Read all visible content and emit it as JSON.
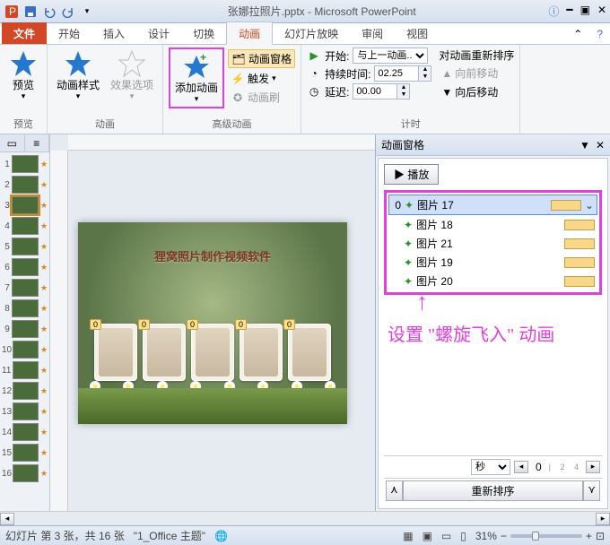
{
  "title": "张娜拉照片.pptx - Microsoft PowerPoint",
  "tabs": {
    "file": "文件",
    "home": "开始",
    "insert": "插入",
    "design": "设计",
    "transitions": "切换",
    "animations": "动画",
    "slideshow": "幻灯片放映",
    "review": "审阅",
    "view": "视图"
  },
  "ribbon": {
    "preview": {
      "label": "预览",
      "group": "预览"
    },
    "animStyle": "动画样式",
    "effectOpts": "效果选项",
    "animGroup": "动画",
    "addAnim": "添加动画",
    "animPane": "动画窗格",
    "trigger": "触发",
    "animPainter": "动画刷",
    "advGroup": "高级动画",
    "start": "开始:",
    "startVal": "与上一动画...",
    "duration": "持续时间:",
    "durationVal": "02.25",
    "delay": "延迟:",
    "delayVal": "00.00",
    "timingGroup": "计时",
    "reorderTitle": "对动画重新排序",
    "moveUp": "向前移动",
    "moveDown": "向后移动"
  },
  "thumbs": {
    "count": 16,
    "selected": 3
  },
  "slide": {
    "title": "狸窝照片制作视频软件",
    "tags": [
      "0",
      "0",
      "0",
      "0",
      "0"
    ]
  },
  "pane": {
    "title": "动画窗格",
    "play": "▶ 播放",
    "items": [
      {
        "idx": "0",
        "name": "图片 17",
        "sel": true,
        "barLeft": 0
      },
      {
        "idx": "",
        "name": "图片 18",
        "barLeft": 20
      },
      {
        "idx": "",
        "name": "图片 21",
        "barLeft": 40
      },
      {
        "idx": "",
        "name": "图片 19",
        "barLeft": 60
      },
      {
        "idx": "",
        "name": "图片 20",
        "barLeft": 80
      }
    ],
    "secUnit": "秒",
    "secVal": "0",
    "reorder": "重新排序"
  },
  "annotation": "设置 \"螺旋飞入\" 动画",
  "status": {
    "slide": "幻灯片 第 3 张，共 16 张",
    "theme": "\"1_Office 主题\"",
    "lang": "",
    "zoom": "31%"
  }
}
